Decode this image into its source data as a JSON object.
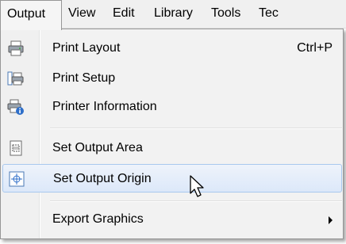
{
  "menubar": {
    "items": [
      {
        "label": "Output",
        "active": true
      },
      {
        "label": "View",
        "active": false
      },
      {
        "label": "Edit",
        "active": false
      },
      {
        "label": "Library",
        "active": false
      },
      {
        "label": "Tools",
        "active": false
      },
      {
        "label": "Tec",
        "active": false
      }
    ]
  },
  "dropdown": {
    "items": [
      {
        "label": "Print Layout",
        "shortcut": "Ctrl+P",
        "icon": "printer-icon"
      },
      {
        "label": "Print Setup",
        "icon": "print-setup-icon"
      },
      {
        "label": "Printer Information",
        "icon": "printer-info-icon"
      },
      {
        "label": "Set Output Area",
        "icon": "output-area-icon"
      },
      {
        "label": "Set Output Origin",
        "icon": "output-origin-icon",
        "highlighted": true
      },
      {
        "label": "Export Graphics",
        "has_submenu": true
      }
    ]
  },
  "colors": {
    "highlight_border": "#a8c8ee",
    "highlight_fill": "#dce8f9",
    "menu_bg": "#f2f2f2"
  }
}
